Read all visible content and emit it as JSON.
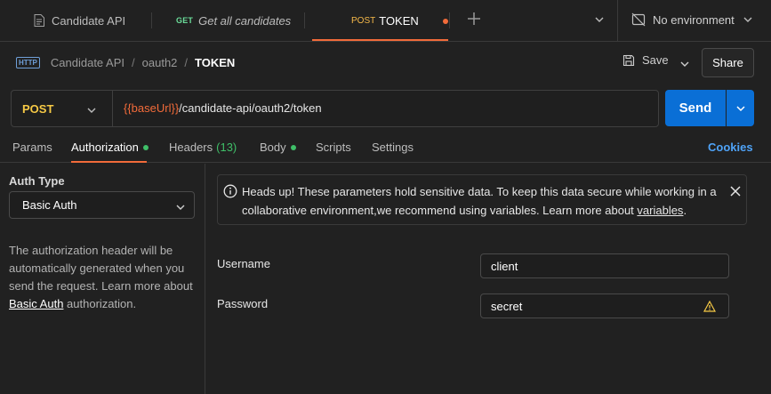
{
  "tabs": [
    {
      "label": "Candidate API",
      "icon": "document-icon"
    },
    {
      "method": "GET",
      "label": "Get all candidates"
    },
    {
      "method": "POST",
      "label": "TOKEN",
      "unsaved": true
    }
  ],
  "environment": {
    "label": "No environment",
    "icon": "no-environment-icon"
  },
  "breadcrumb": {
    "icon_text": "HTTP",
    "collection": "Candidate API",
    "folder": "oauth2",
    "current": "TOKEN"
  },
  "toolbar": {
    "save_label": "Save",
    "share_label": "Share"
  },
  "request": {
    "method": "POST",
    "url_var": "{{baseUrl}}",
    "url_path": "/candidate-api/oauth2/token",
    "send_label": "Send"
  },
  "request_tabs": {
    "params": "Params",
    "authorization": "Authorization",
    "headers": "Headers",
    "headers_count": "(13)",
    "body": "Body",
    "scripts": "Scripts",
    "settings": "Settings",
    "cookies": "Cookies"
  },
  "auth": {
    "type_label": "Auth Type",
    "type_value": "Basic Auth",
    "desc_1": "The authorization header will be automatically generated when you send the request. Learn more about ",
    "desc_link": "Basic Auth",
    "desc_2": " authorization."
  },
  "notice": {
    "text": "Heads up! These parameters hold sensitive data. To keep this data secure while working in a collaborative environment,we recommend using variables. Learn more about ",
    "link": "variables",
    "end": "."
  },
  "fields": {
    "username_label": "Username",
    "username_value": "client",
    "password_label": "Password",
    "password_value": "secret"
  },
  "colors": {
    "accent": "#f26b3a",
    "send": "#0a6fd6",
    "post": "#f6c945",
    "get": "#6bdd9a",
    "link": "#4fa3f7",
    "status_dot": "#3fbf68"
  }
}
